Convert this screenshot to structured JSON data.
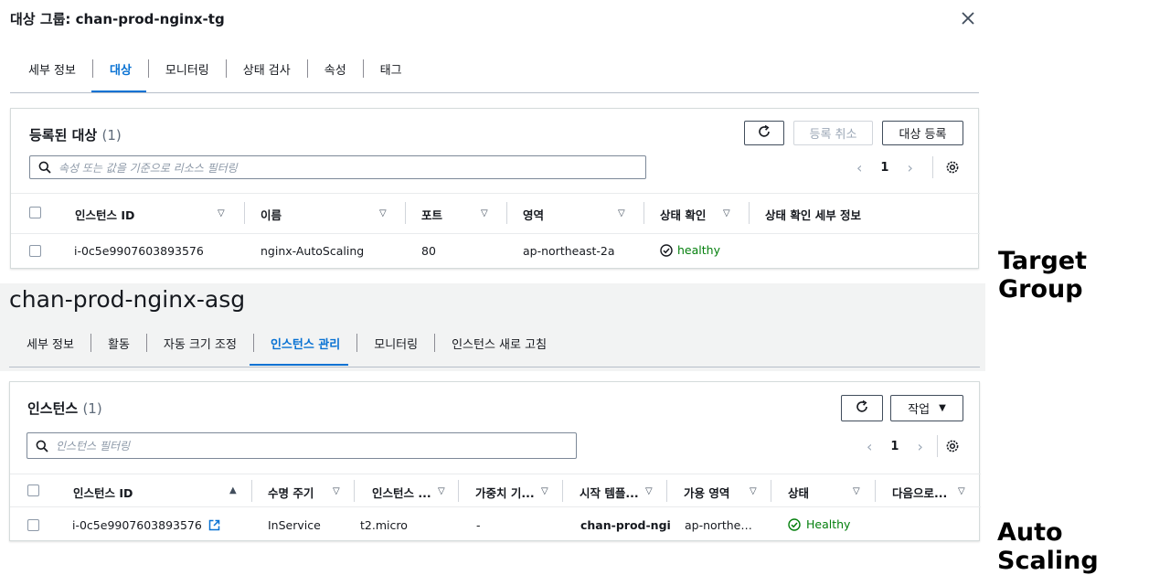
{
  "tg": {
    "title": "대상 그룹: chan-prod-nginx-tg",
    "tabs": [
      "세부 정보",
      "대상",
      "모니터링",
      "상태 검사",
      "속성",
      "태그"
    ],
    "panel_title": "등록된 대상",
    "count": "(1)",
    "deregister_label": "등록 취소",
    "register_label": "대상 등록",
    "search_placeholder": "속성 또는 값을 기준으로 리소스 필터링",
    "page": "1",
    "columns": [
      "인스턴스 ID",
      "이름",
      "포트",
      "영역",
      "상태 확인",
      "상태 확인 세부 정보"
    ],
    "row": {
      "instance_id": "i-0c5e9907603893576",
      "name": "nginx-AutoScaling",
      "port": "80",
      "zone": "ap-northeast-2a",
      "health": "healthy",
      "health_details": ""
    }
  },
  "asg": {
    "title": "chan-prod-nginx-asg",
    "tabs": [
      "세부 정보",
      "활동",
      "자동 크기 조정",
      "인스턴스 관리",
      "모니터링",
      "인스턴스 새로 고침"
    ],
    "panel_title": "인스턴스",
    "count": "(1)",
    "actions_label": "작업",
    "search_placeholder": "인스턴스 필터링",
    "page": "1",
    "columns": [
      "인스턴스 ID",
      "수명 주기",
      "인스턴스 ...",
      "가중치 기...",
      "시작 템플...",
      "가용 영역",
      "상태",
      "다음으로..."
    ],
    "row": {
      "instance_id": "i-0c5e9907603893576",
      "lifecycle": "InService",
      "instance_type": "t2.micro",
      "weight": "-",
      "launch_template": "chan-prod-ngin",
      "az": "ap-northe…",
      "health": "Healthy",
      "next": ""
    }
  },
  "labels": {
    "target_group": "Target Group",
    "auto_scaling": "Auto Scaling"
  },
  "colors": {
    "link": "#0972d3",
    "healthy": "#037f0c"
  }
}
